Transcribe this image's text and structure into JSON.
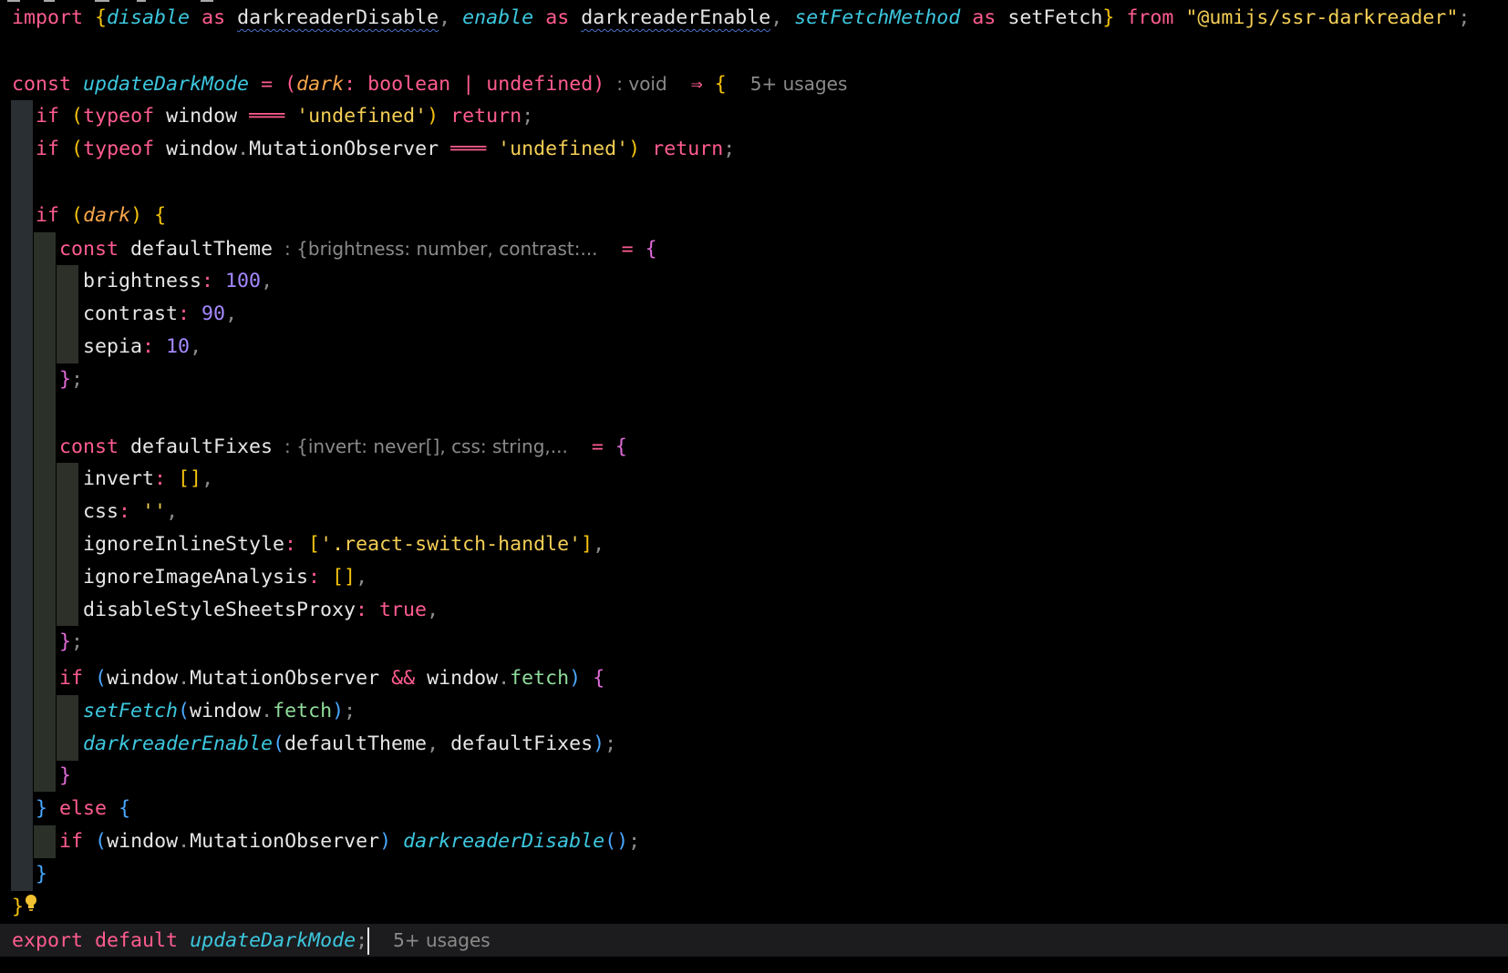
{
  "editor": {
    "language": "typescript",
    "theme_colors": {
      "background": "#000000",
      "keyword": "#ff5c8f",
      "function": "#3cc7de",
      "parameter": "#f7a54a",
      "string": "#f4ce54",
      "number": "#a489ff",
      "property": "#8fdc9b",
      "inlay_hint": "#8a8a8a",
      "current_line": "#1c1c1e"
    },
    "icons": {
      "intention_bulb": "lightbulb-icon"
    },
    "inlay_hints": {
      "return_type": ": void",
      "usages": "5+ usages",
      "default_theme_type": ": {brightness: number, contrast:...",
      "default_fixes_type": ": {invert: never[], css: string,...",
      "export_usages": "5+ usages"
    },
    "lines": [
      "import {disable as darkreaderDisable, enable as darkreaderEnable, setFetchMethod as setFetch} from \"@umijs/ssr-darkreader\";",
      "",
      "const updateDarkMode = (dark: boolean | undefined) ⇒ {",
      "if (typeof window ═══ 'undefined') return;",
      "if (typeof window.MutationObserver ═══ 'undefined') return;",
      "",
      "if (dark) {",
      "const defaultTheme = {",
      "brightness: 100,",
      "contrast: 90,",
      "sepia: 10,",
      "};",
      "",
      "const defaultFixes = {",
      "invert: [],",
      "css: '',",
      "ignoreInlineStyle: ['.react-switch-handle'],",
      "ignoreImageAnalysis: [],",
      "disableStyleSheetsProxy: true,",
      "};",
      "if (window.MutationObserver && window.fetch) {",
      "setFetch(window.fetch);",
      "darkreaderEnable(defaultTheme, defaultFixes);",
      "}",
      "} else {",
      "if (window.MutationObserver) darkreaderDisable();",
      "}",
      "}",
      "export default updateDarkMode;"
    ]
  }
}
